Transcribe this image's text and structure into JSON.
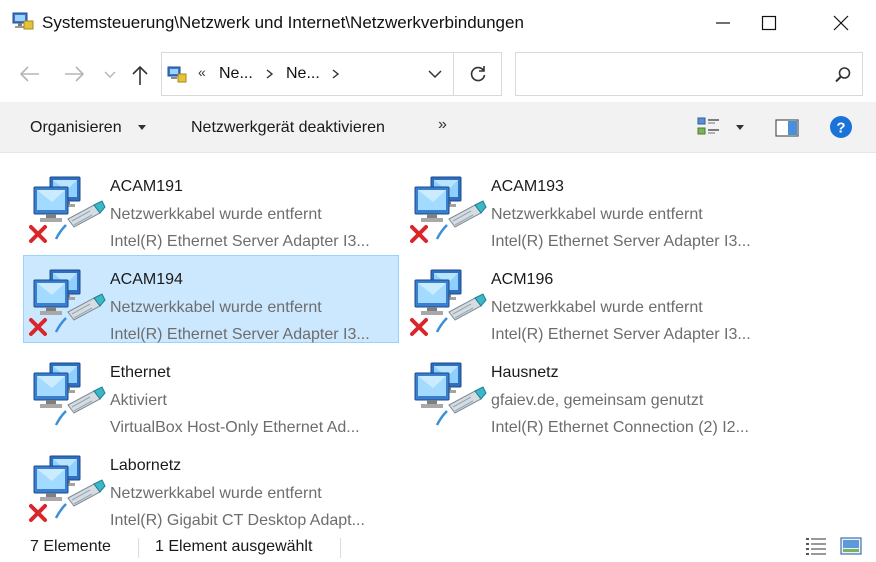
{
  "window": {
    "title": "Systemsteuerung\\Netzwerk und Internet\\Netzwerkverbindungen"
  },
  "address": {
    "overflow_chevron": "«",
    "crumbs": [
      "Ne...",
      "Ne..."
    ],
    "icon": "network-connections-icon"
  },
  "search": {
    "value": "",
    "placeholder": ""
  },
  "commands": {
    "organize": "Organisieren",
    "deactivate": "Netzwerkgerät deaktivieren",
    "more": "»"
  },
  "items": [
    {
      "name": "ACAM191",
      "status": "Netzwerkkabel wurde entfernt",
      "device": "Intel(R) Ethernet Server Adapter I3...",
      "disconnected": true,
      "selected": false
    },
    {
      "name": "ACAM193",
      "status": "Netzwerkkabel wurde entfernt",
      "device": "Intel(R) Ethernet Server Adapter I3...",
      "disconnected": true,
      "selected": false
    },
    {
      "name": "ACAM194",
      "status": "Netzwerkkabel wurde entfernt",
      "device": "Intel(R) Ethernet Server Adapter I3...",
      "disconnected": true,
      "selected": true
    },
    {
      "name": "ACM196",
      "status": "Netzwerkkabel wurde entfernt",
      "device": "Intel(R) Ethernet Server Adapter I3...",
      "disconnected": true,
      "selected": false
    },
    {
      "name": "Ethernet",
      "status": "Aktiviert",
      "device": "VirtualBox Host-Only Ethernet Ad...",
      "disconnected": false,
      "selected": false
    },
    {
      "name": "Hausnetz",
      "status": "gfaiev.de, gemeinsam genutzt",
      "device": "Intel(R) Ethernet Connection (2) I2...",
      "disconnected": false,
      "selected": false
    },
    {
      "name": "Labornetz",
      "status": "Netzwerkkabel wurde entfernt",
      "device": "Intel(R) Gigabit CT Desktop Adapt...",
      "disconnected": true,
      "selected": false
    }
  ],
  "status": {
    "count": "7  Elemente",
    "selected": "1 Element ausgewählt"
  },
  "colors": {
    "selection_bg": "#cce8ff",
    "selection_border": "#99d1ff",
    "help_blue": "#1a73d9",
    "disconnected_red": "#d8262b"
  }
}
